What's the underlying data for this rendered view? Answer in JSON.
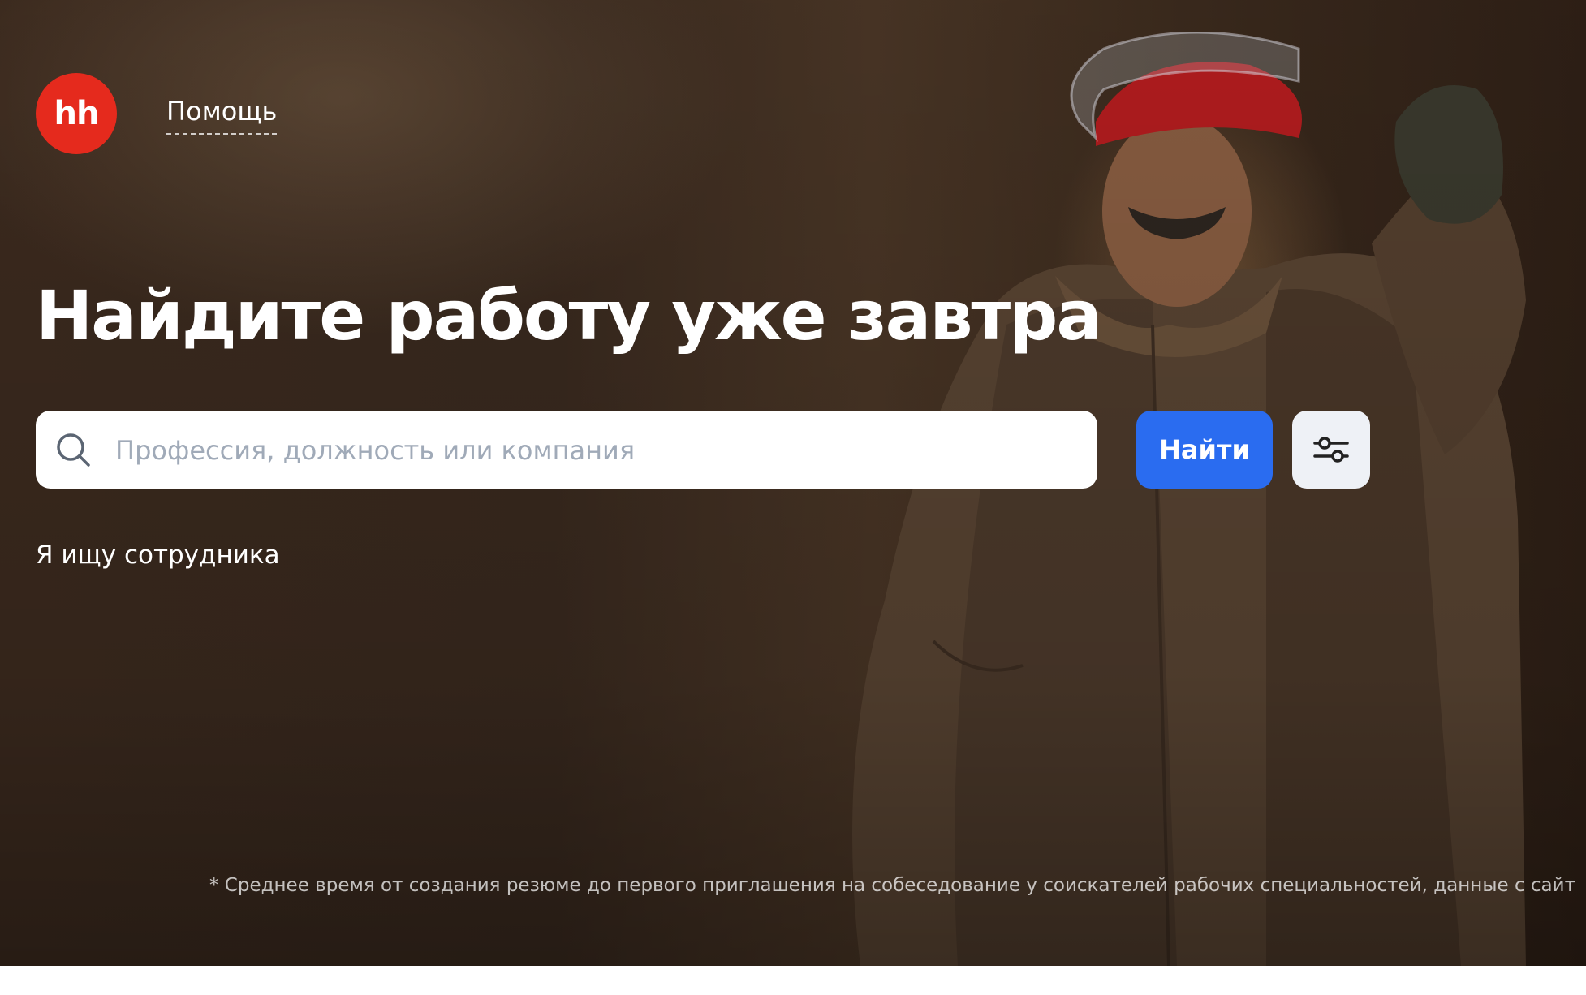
{
  "header": {
    "logo_text": "hh",
    "help_label": "Помощь"
  },
  "hero": {
    "headline": "Найдите работу уже завтра",
    "search": {
      "placeholder": "Профессия, должность или компания",
      "value": ""
    },
    "find_button_label": "Найти",
    "employer_link": "Я ищу сотрудника",
    "footnote": "* Среднее время от создания резюме до первого приглашения на собеседование у соискателей рабочих специальностей, данные с сайт"
  },
  "colors": {
    "brand_red": "#e52a1d",
    "accent_blue": "#2a6cf0",
    "filter_bg": "#eef1f6",
    "placeholder": "#a0aab8"
  },
  "icons": {
    "search": "search-icon",
    "filter": "sliders-icon"
  }
}
